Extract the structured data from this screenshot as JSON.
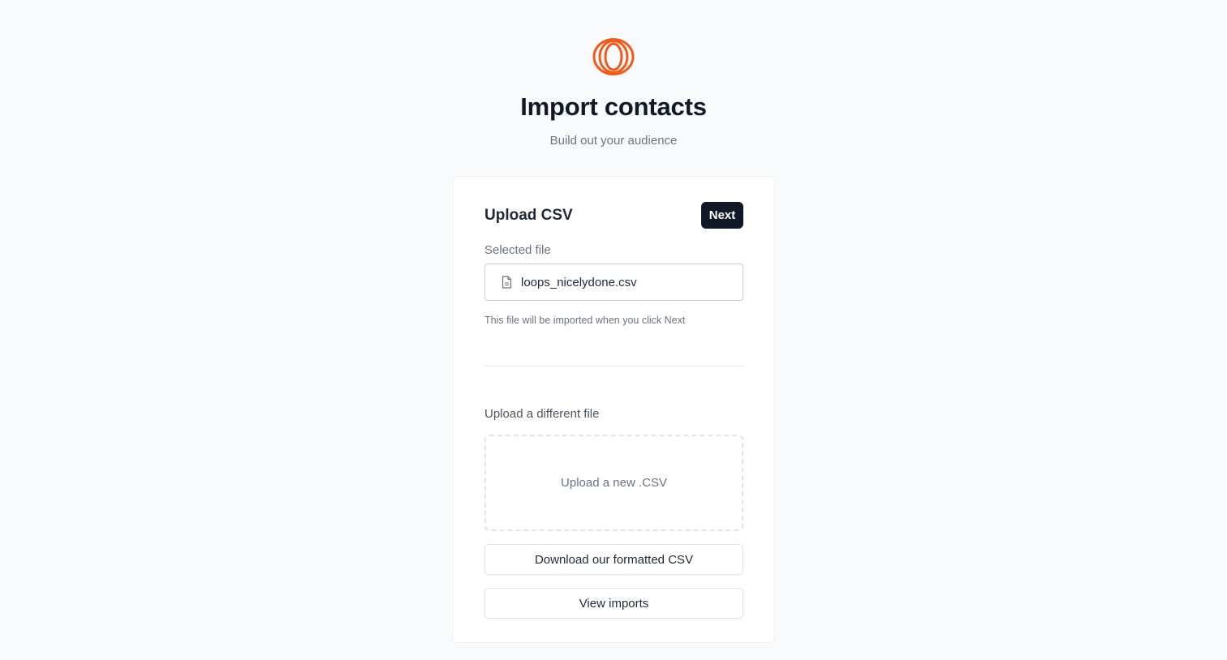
{
  "brand": {
    "logo_icon": "loops-logo-icon",
    "accent_color": "#f05a1a"
  },
  "header": {
    "title": "Import contacts",
    "subtitle": "Build out your audience"
  },
  "card": {
    "title": "Upload CSV",
    "next_label": "Next",
    "selected_file_label": "Selected file",
    "selected_file_name": "loops_nicelydone.csv",
    "file_icon": "file-document-icon",
    "hint": "This file will be imported when you click Next",
    "different_file_label": "Upload a different file",
    "dropzone_label": "Upload a new .CSV",
    "download_label": "Download our formatted CSV",
    "view_imports_label": "View imports"
  }
}
